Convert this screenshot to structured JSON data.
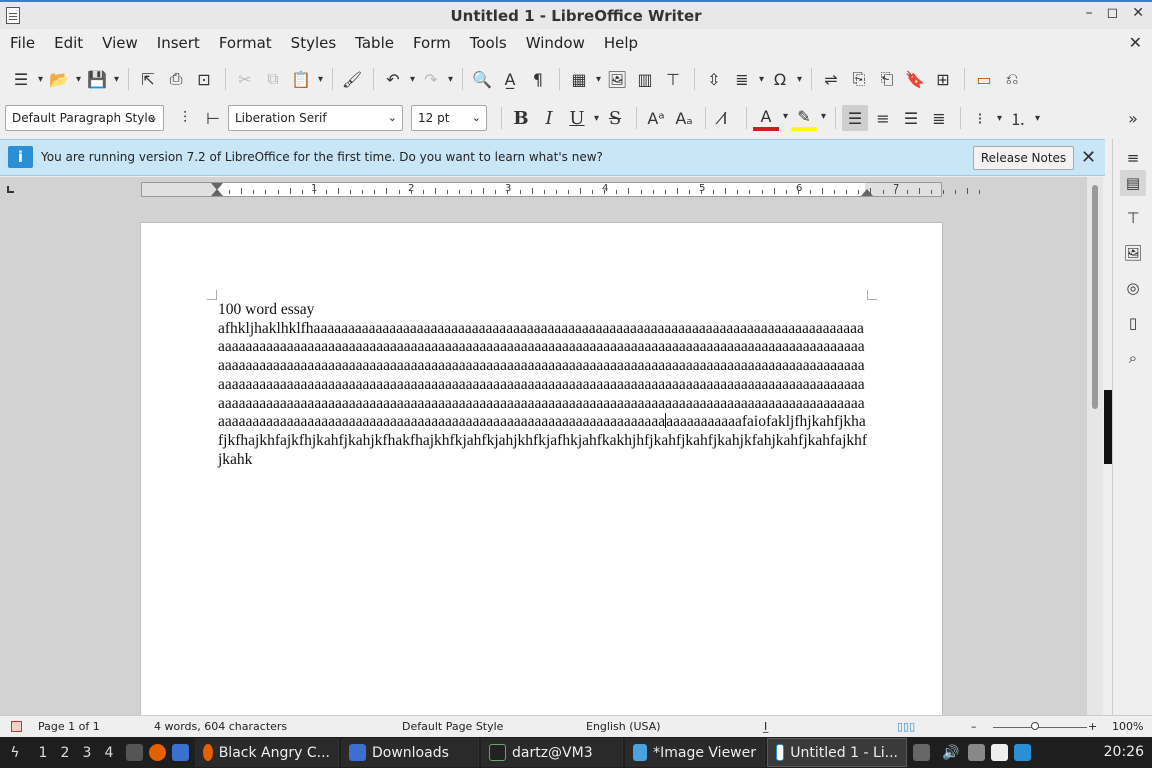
{
  "window": {
    "title": "Untitled 1 - LibreOffice Writer",
    "controls": [
      "–",
      "◻",
      "✕"
    ]
  },
  "menu": [
    "File",
    "Edit",
    "View",
    "Insert",
    "Format",
    "Styles",
    "Table",
    "Form",
    "Tools",
    "Window",
    "Help"
  ],
  "toolbar2": {
    "paragraph_style": "Default Paragraph Style",
    "font_name": "Liberation Serif",
    "font_size": "12 pt"
  },
  "infobar": {
    "message": "You are running version 7.2 of LibreOffice for the first time. Do you want to learn what's new?",
    "button": "Release Notes"
  },
  "ruler": {
    "numbers": [
      "1",
      "2",
      "3",
      "4",
      "5",
      "6",
      "7"
    ]
  },
  "document": {
    "line1": "100 word essay",
    "body_before_cursor": "afhkljhaklhklfhaaaaaaaaaaaaaaaaaaaaaaaaaaaaaaaaaaaaaaaaaaaaaaaaaaaaaaaaaaaaaaaaaaaaaaaaaaaaaaaaaaaaaaaaaaaaaaaaaaaaaaaaaaaaaaaaaaaaaaaaaaaaaaaaaaaaaaaaaaaaaaaaaaaaaaaaaaaaaaaaaaaaaaaaaaaaaaaaaaaaaaaaaaaaaaaaaaaaaaaaaaaaaaaaaaaaaaaaaaaaaaaaaaaaaaaaaaaaaaaaaaaaaaaaaaaaaaaaaaaaaaaaaaaaaaaaaaaaaaaaaaaaaaaaaaaaaaaaaaaaaaaaaaaaaaaaaaaaaaaaaaaaaaaaaaaaaaaaaaaaaaaaaaaaaaaaaaaaaaaaaaaaaaaaaaaaaaaaaaaaaaaaaaaaaaaaaaaaaaaaaaaaaaaaaaaaaaaaaaaaaaaaaaaaaaaaaaaaaaaaaaaaaaaaaaaaaaaaaaaaaaaaaaaaaaaaaaaaaaaaaaaaaaaaaaaaaaaaaaaaaaaaaaaaaaaaaaaaaaaaa",
    "body_after_cursor": "aaaaaaaaaaafaiofakljfhjkahfjkhafjkfhajkhfajkfhjkahfjkahjkfhakfhajkhfkjahfkjahjkhfkjafhkjahfkakhjhfjkahfjkahfjkahjkfahjkahfjkahfajkhfjkahk"
  },
  "status": {
    "page": "Page 1 of 1",
    "words": "4 words, 604 characters",
    "page_style": "Default Page Style",
    "language": "English (USA)",
    "zoom": "100%"
  },
  "taskbar": {
    "workspaces": [
      "1",
      "2",
      "3",
      "4"
    ],
    "apps": [
      "Black Angry C...",
      "Downloads",
      "dartz@VM3",
      "*Image Viewer",
      "Untitled 1 - Li..."
    ],
    "clock": "20:26"
  }
}
